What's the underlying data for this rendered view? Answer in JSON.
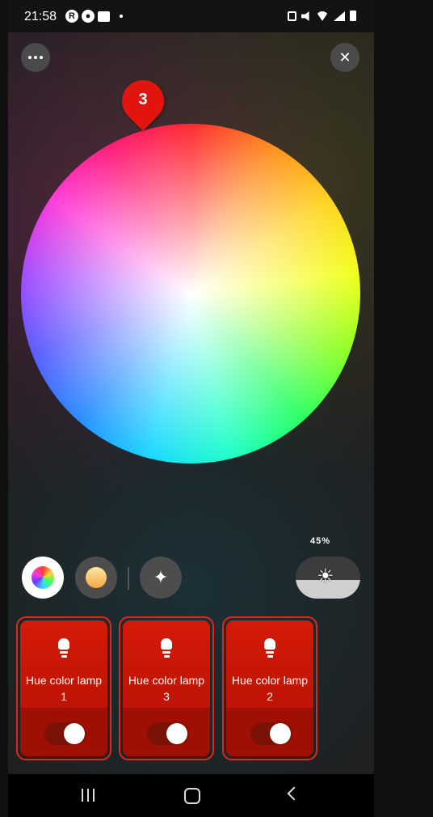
{
  "status_bar": {
    "time": "21:58",
    "left_icons": [
      "r-badge-icon",
      "account-icon",
      "image-icon",
      "dot-icon"
    ],
    "right_icons": [
      "nfc-icon",
      "mute-icon",
      "wifi-icon",
      "signal-icon",
      "battery-icon"
    ]
  },
  "top_bar": {
    "menu_icon": "more-horizontal-icon",
    "close_glyph": "✕"
  },
  "color_wheel": {
    "marker_count": "3"
  },
  "modes": {
    "color_icon": "color-palette-icon",
    "white_icon": "white-temperature-icon",
    "effects_glyph": "✦"
  },
  "brightness": {
    "label": "45%",
    "value": 0.45,
    "icon_glyph": "☀"
  },
  "lamps": [
    {
      "name": "Hue color lamp 1",
      "on": true
    },
    {
      "name": "Hue color lamp 3",
      "on": true
    },
    {
      "name": "Hue color lamp 2",
      "on": true
    }
  ],
  "colors": {
    "accent_red": "#d51a08",
    "card_border": "#e02818"
  },
  "nav_bar": {
    "icons": [
      "recent-apps-icon",
      "home-icon",
      "back-icon"
    ]
  }
}
